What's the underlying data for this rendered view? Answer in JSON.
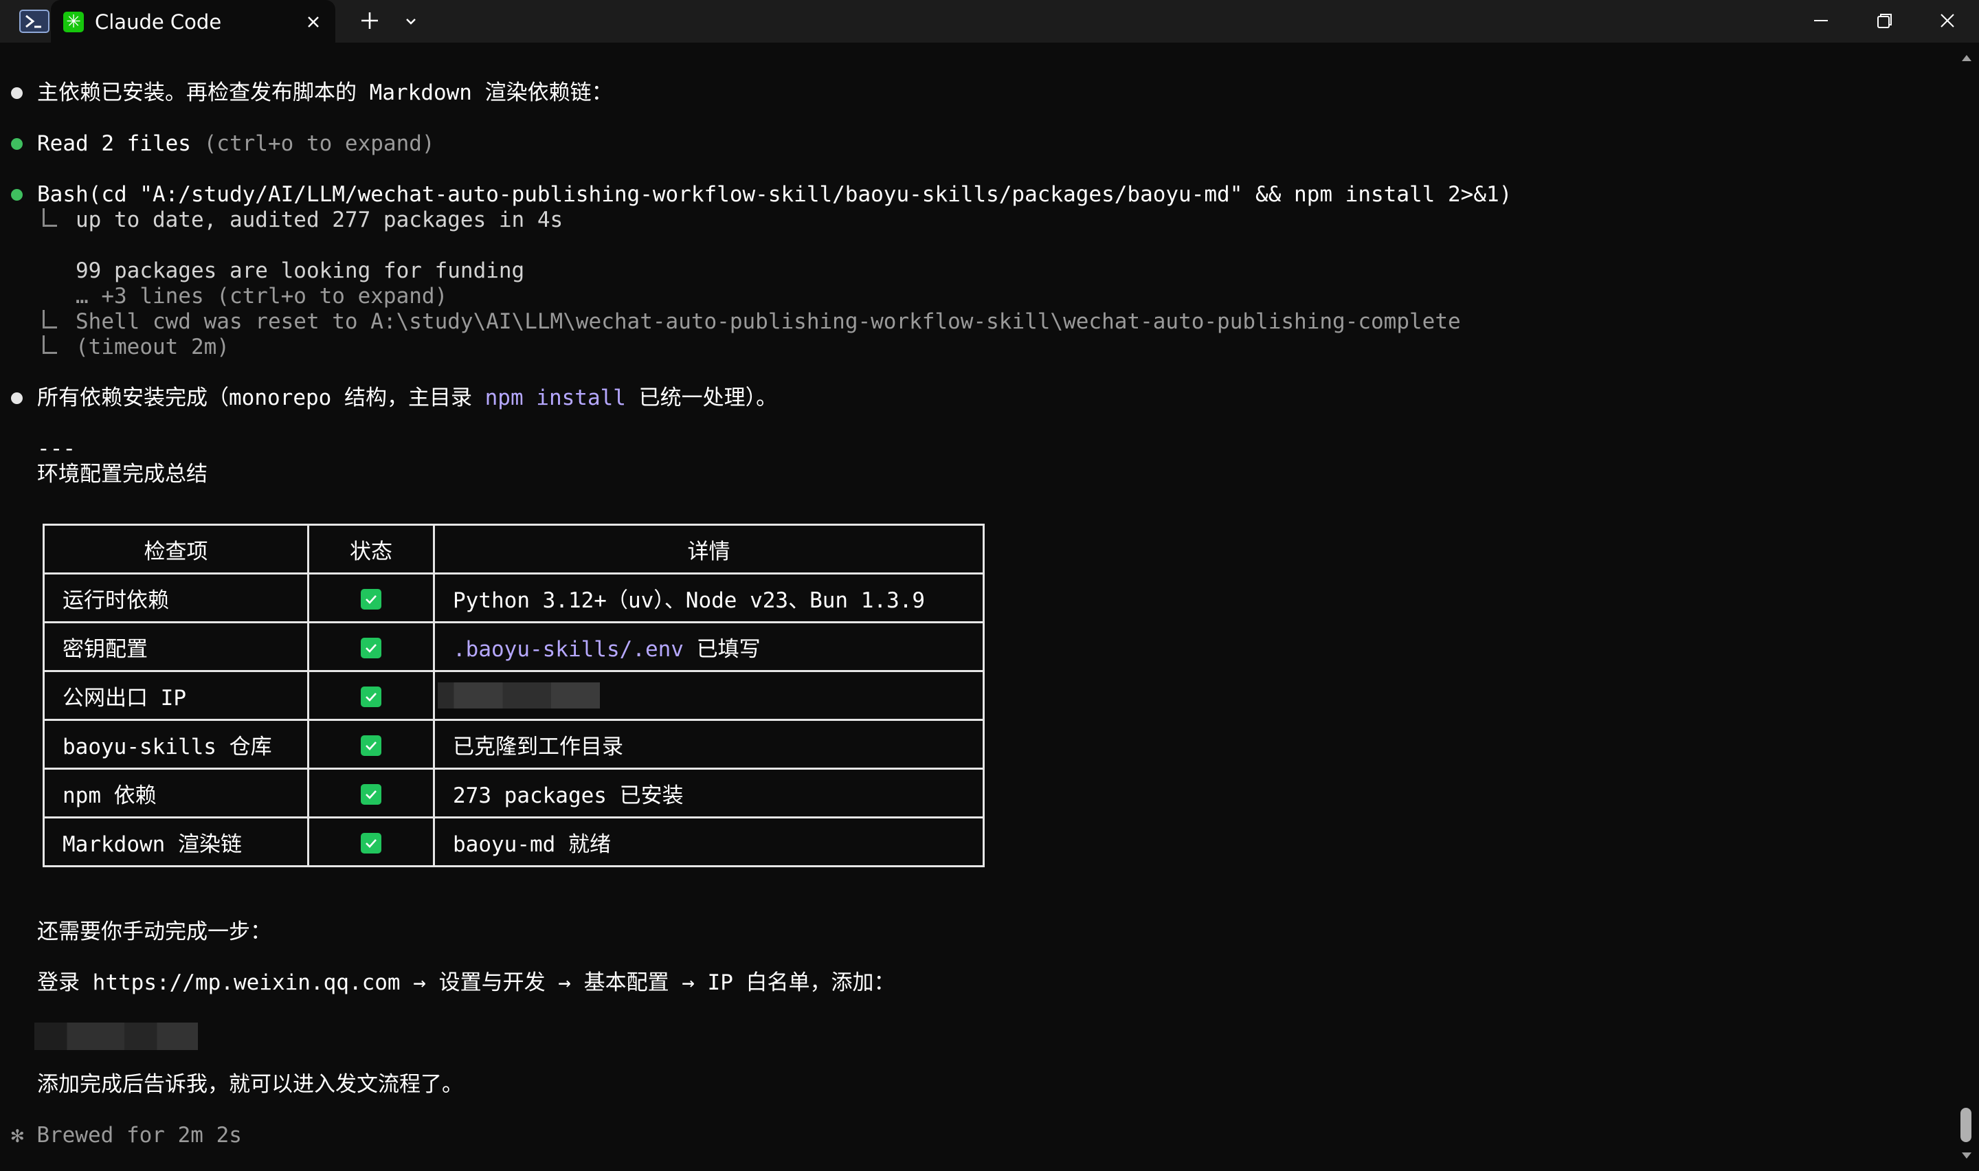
{
  "window": {
    "tab_title": "Claude Code",
    "new_tab_glyph": "+",
    "dropdown_glyph": "⌄",
    "icons": [
      "powershell-icon",
      "claude-code-icon",
      "close-icon",
      "plus-icon",
      "chevron-down-icon",
      "minimize-icon",
      "maximize-icon",
      "close-icon"
    ]
  },
  "terminal": {
    "msg1": "主依赖已安装。再检查发布脚本的 Markdown 渲染依赖链：",
    "read": {
      "bold": "Read 2 files",
      "hint": " (ctrl+o to expand)"
    },
    "bash": {
      "bold": "Bash",
      "cmd": "(cd \"A:/study/AI/LLM/wechat-auto-publishing-workflow-skill/baoyu-skills/packages/baoyu-md\" && npm install 2>&1)"
    },
    "out1": "up to date, audited 277 packages in 4s",
    "out2": "99 packages are looking for funding",
    "out3": "… +3 lines (ctrl+o to expand)",
    "out4": "Shell cwd was reset to A:\\study\\AI\\LLM\\wechat-auto-publishing-workflow-skill\\wechat-auto-publishing-complete",
    "out5": "(timeout 2m)",
    "msg2": {
      "pre": "所有依赖安装完成（monorepo 结构，主目录 ",
      "code": "npm install",
      "post": " 已统一处理）。"
    },
    "rule": "---",
    "summary_title": "环境配置完成总结",
    "table": {
      "headers": [
        "检查项",
        "状态",
        "详情"
      ],
      "rows": [
        {
          "item": "运行时依赖",
          "detail": "Python 3.12+（uv）、Node v23、Bun 1.3.9"
        },
        {
          "item": "密钥配置",
          "detail_code": ".baoyu-skills/.env",
          "detail": " 已填写"
        },
        {
          "item": "公网出口 IP",
          "detail": ""
        },
        {
          "item": "baoyu-skills 仓库",
          "detail": "已克隆到工作目录"
        },
        {
          "item": "npm 依赖",
          "detail": "273 packages 已安装"
        },
        {
          "item": "Markdown 渲染链",
          "detail": "baoyu-md 就绪"
        }
      ]
    },
    "manual_step": "还需要你手动完成一步：",
    "login": "登录 https://mp.weixin.qq.com → 设置与开发 → 基本配置 → IP 白名单，添加：",
    "after": "添加完成后告诉我，就可以进入发文流程了。",
    "status": "✻ Brewed for 2m 2s"
  },
  "colors": {
    "background": "#0c0c0c",
    "titlebar": "#1c1c1c",
    "accent_code": "#b6a8ff",
    "success_bullet": "#3fbf5f",
    "check_green": "#21c55d"
  }
}
